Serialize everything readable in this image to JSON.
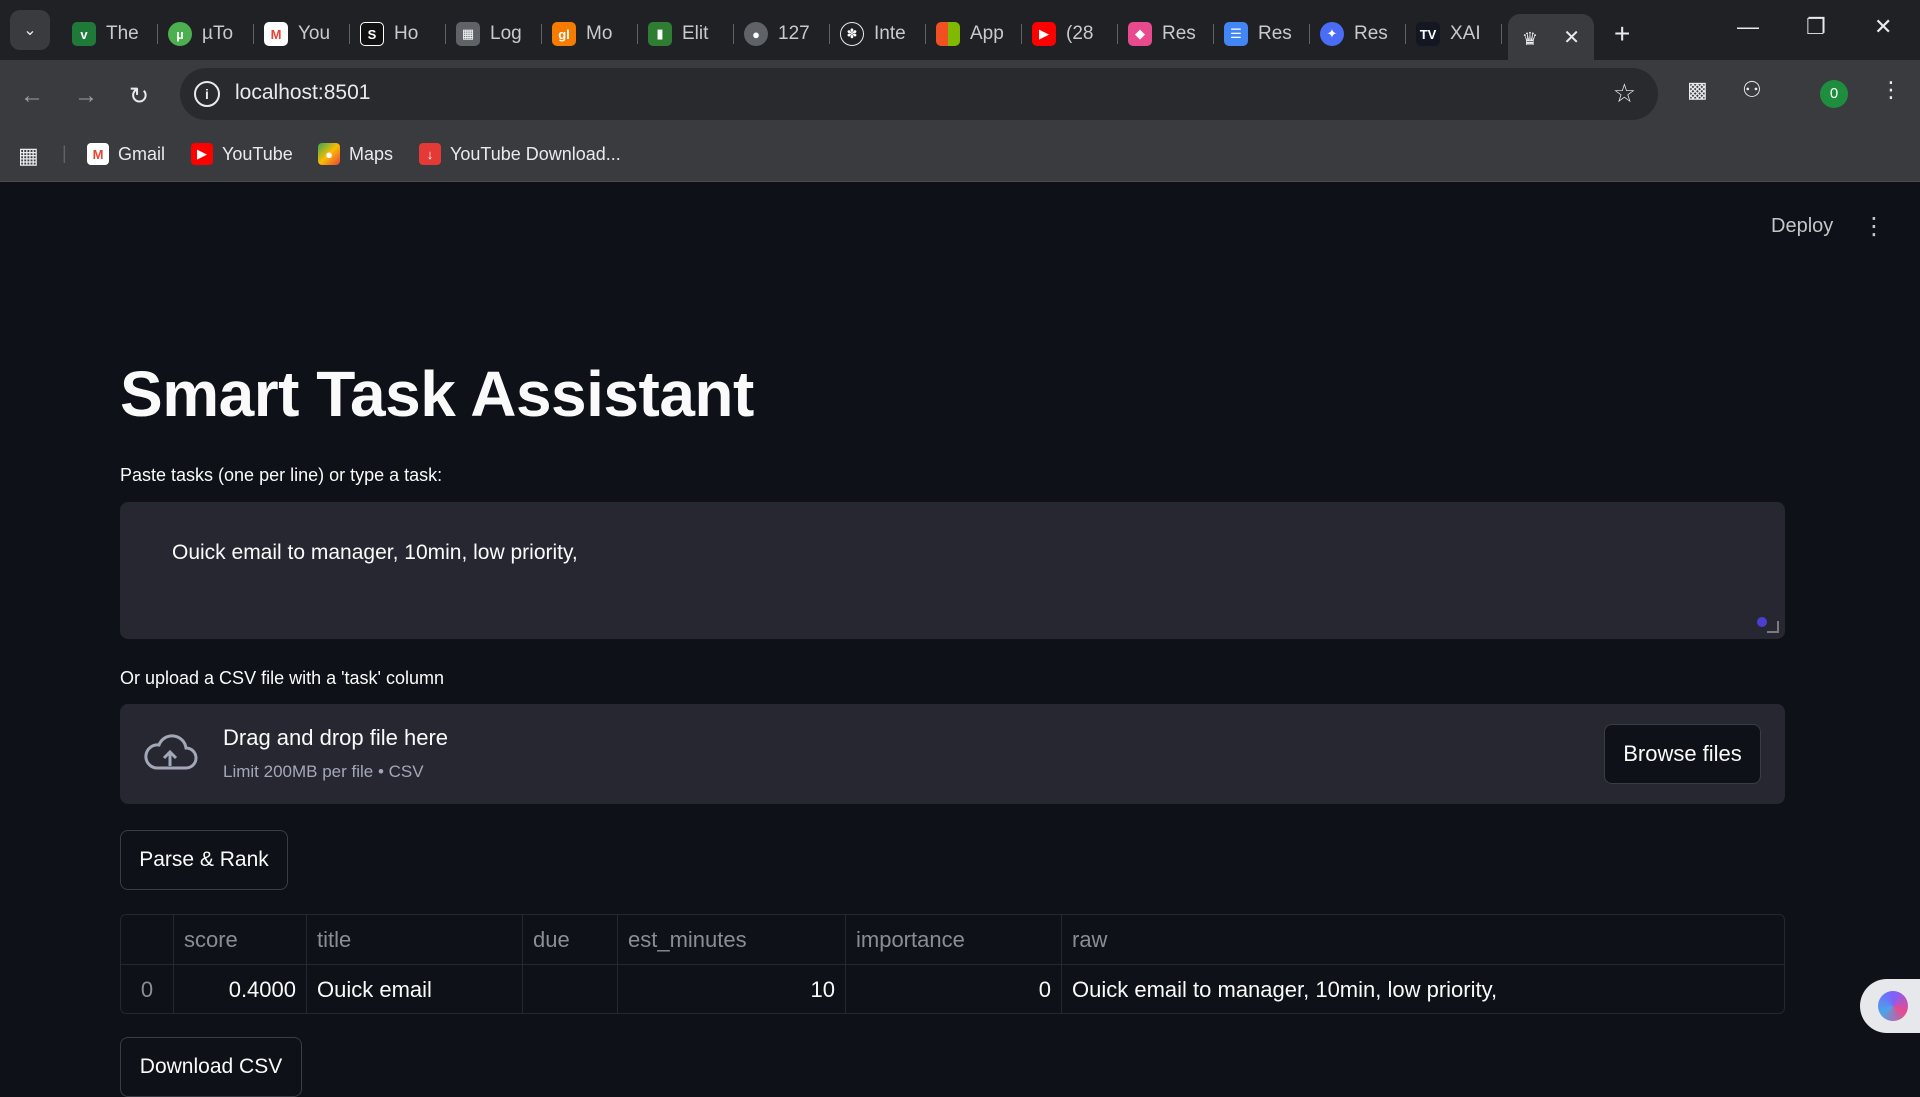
{
  "browser": {
    "tabs": [
      {
        "title": "The",
        "icon": "globe-icon",
        "color": "#1f7a3a"
      },
      {
        "title": "µTo",
        "icon": "utorrent-icon",
        "color": "#4caf50"
      },
      {
        "title": "You",
        "icon": "gmail-icon",
        "color": "#ea4335"
      },
      {
        "title": "Ho",
        "icon": "hotjar-icon",
        "color": "#111111"
      },
      {
        "title": "Log",
        "icon": "grid-icon",
        "color": "#5f6368"
      },
      {
        "title": "Mo",
        "icon": "glitch-icon",
        "color": "#f57c00"
      },
      {
        "title": "Elit",
        "icon": "signal-bars-icon",
        "color": "#2e7d32"
      },
      {
        "title": "127",
        "icon": "globe-icon",
        "color": "#5f6368"
      },
      {
        "title": "Inte",
        "icon": "openai-icon",
        "color": "#202124"
      },
      {
        "title": "App",
        "icon": "microsoft-icon",
        "color": "#f25022"
      },
      {
        "title": "(28",
        "icon": "youtube-icon",
        "color": "#ff0000"
      },
      {
        "title": "Res",
        "icon": "eraser-icon",
        "color": "#e84a8e"
      },
      {
        "title": "Res",
        "icon": "docs-icon",
        "color": "#4285f4"
      },
      {
        "title": "Res",
        "icon": "bird-icon",
        "color": "#4a6cf7"
      },
      {
        "title": "XAI",
        "icon": "tradingview-icon",
        "color": "#131722"
      }
    ],
    "active_tab_icon": "crown-icon",
    "url": "localhost:8501",
    "profile_initial": "0",
    "bookmarks": [
      {
        "label": "Gmail",
        "icon": "gmail-icon"
      },
      {
        "label": "YouTube",
        "icon": "youtube-icon"
      },
      {
        "label": "Maps",
        "icon": "maps-icon"
      },
      {
        "label": "YouTube Download...",
        "icon": "download-icon"
      }
    ]
  },
  "app": {
    "deploy_label": "Deploy",
    "title": "Smart Task Assistant",
    "textarea_label": "Paste tasks (one per line) or type a task:",
    "textarea_value": "Ouick email to manager, 10min, low priority,",
    "upload_label": "Or upload a CSV file with a 'task' column",
    "dropzone_main": "Drag and drop file here",
    "dropzone_sub": "Limit 200MB per file • CSV",
    "browse_label": "Browse files",
    "parse_label": "Parse & Rank",
    "download_label": "Download CSV",
    "table": {
      "columns": [
        "",
        "score",
        "title",
        "due",
        "est_minutes",
        "importance",
        "raw"
      ],
      "rows": [
        [
          "0",
          "0.4000",
          "Ouick email",
          "",
          "10",
          "0",
          "Ouick email to manager, 10min, low priority,"
        ]
      ]
    }
  }
}
